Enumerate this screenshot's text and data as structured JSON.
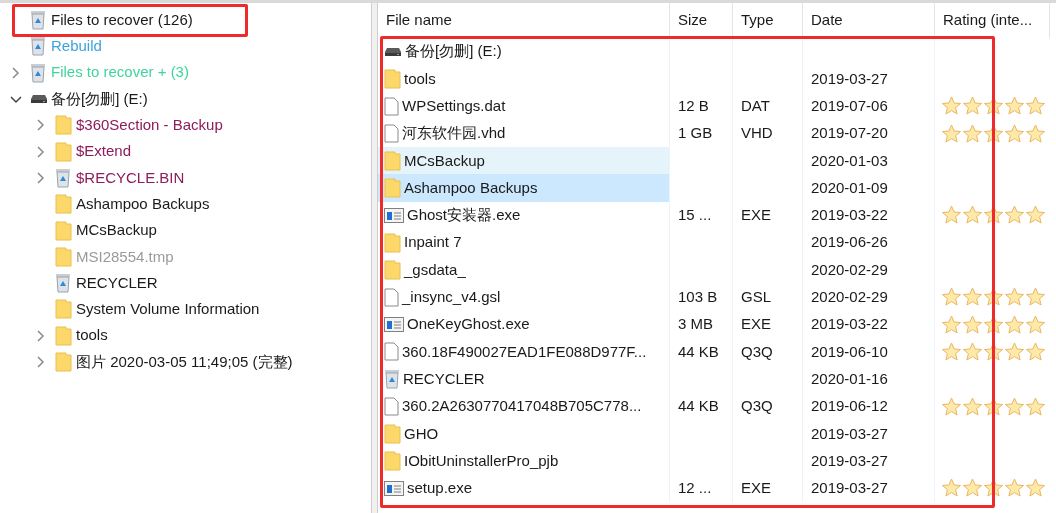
{
  "tree": [
    {
      "label": "Files to recover (126)",
      "kind": "recycle",
      "expandable": false,
      "color": "#1a1a1a",
      "highlighted": true
    },
    {
      "label": "Rebuild",
      "kind": "recycle",
      "expandable": false,
      "color": "#3ba3dc",
      "highlighted": false
    },
    {
      "label": "Files to recover + (3)",
      "kind": "recycle",
      "expandable": true,
      "expanded": false,
      "color": "#3fd49c",
      "highlighted": false
    },
    {
      "label": "备份[勿删] (E:)",
      "kind": "drive",
      "expandable": true,
      "expanded": true,
      "color": "#1a1a1a",
      "highlighted": false,
      "children": [
        {
          "label": "$360Section - Backup",
          "kind": "folder",
          "expandable": true,
          "expanded": false,
          "color": "#8e1b5c",
          "highlighted": false
        },
        {
          "label": "$Extend",
          "kind": "folder",
          "expandable": true,
          "expanded": false,
          "color": "#8e1b5c",
          "highlighted": false
        },
        {
          "label": "$RECYCLE.BIN",
          "kind": "recycle",
          "expandable": true,
          "expanded": false,
          "color": "#8e1b5c",
          "highlighted": false
        },
        {
          "label": "Ashampoo Backups",
          "kind": "folder",
          "expandable": false,
          "color": "#1a1a1a",
          "highlighted": false
        },
        {
          "label": "MCsBackup",
          "kind": "folder",
          "expandable": false,
          "color": "#1a1a1a",
          "highlighted": false
        },
        {
          "label": "MSI28554.tmp",
          "kind": "folder",
          "expandable": false,
          "color": "#9a9a9a",
          "highlighted": false
        },
        {
          "label": "RECYCLER",
          "kind": "recycle",
          "expandable": false,
          "color": "#1a1a1a",
          "highlighted": false
        },
        {
          "label": "System Volume Information",
          "kind": "folder",
          "expandable": false,
          "color": "#1a1a1a",
          "highlighted": false
        },
        {
          "label": "tools",
          "kind": "folder",
          "expandable": true,
          "expanded": false,
          "color": "#1a1a1a",
          "highlighted": false
        },
        {
          "label": "图片 2020-03-05 11;49;05 (完整)",
          "kind": "folder",
          "expandable": true,
          "expanded": false,
          "color": "#1a1a1a",
          "highlighted": false
        }
      ]
    }
  ],
  "table": {
    "highlighted": true,
    "columns": [
      "File name",
      "Size",
      "Type",
      "Date",
      "Rating (inte..."
    ],
    "rows": [
      {
        "kind": "drive",
        "name": "备份[勿删] (E:)",
        "selected": false,
        "hover": false
      },
      {
        "kind": "folder",
        "name": "tools",
        "date": "2019-03-27",
        "selected": false,
        "hover": false
      },
      {
        "kind": "file",
        "name": "WPSettings.dat",
        "size": "12 B",
        "type": "DAT",
        "date": "2019-07-06",
        "stars": 5,
        "selected": false,
        "hover": false
      },
      {
        "kind": "file",
        "name": "河东软件园.vhd",
        "size": "1 GB",
        "type": "VHD",
        "date": "2019-07-20",
        "stars": 5,
        "selected": false,
        "hover": false
      },
      {
        "kind": "folder",
        "name": "MCsBackup",
        "date": "2020-01-03",
        "selected": false,
        "hover": true
      },
      {
        "kind": "folder",
        "name": "Ashampoo Backups",
        "date": "2020-01-09",
        "selected": true,
        "hover": false
      },
      {
        "kind": "exe",
        "name": "Ghost安装器.exe",
        "size": "15 ...",
        "type": "EXE",
        "date": "2019-03-22",
        "stars": 5,
        "selected": false,
        "hover": false
      },
      {
        "kind": "folder",
        "name": "Inpaint 7",
        "date": "2019-06-26",
        "selected": false,
        "hover": false
      },
      {
        "kind": "folder",
        "name": "_gsdata_",
        "date": "2020-02-29",
        "selected": false,
        "hover": false
      },
      {
        "kind": "file",
        "name": "_insync_v4.gsl",
        "size": "103 B",
        "type": "GSL",
        "date": "2020-02-29",
        "stars": 5,
        "selected": false,
        "hover": false
      },
      {
        "kind": "exe",
        "name": "OneKeyGhost.exe",
        "size": "3 MB",
        "type": "EXE",
        "date": "2019-03-22",
        "stars": 5,
        "selected": false,
        "hover": false
      },
      {
        "kind": "file",
        "name": "360.18F490027EAD1FE088D977F...",
        "size": "44 KB",
        "type": "Q3Q",
        "date": "2019-06-10",
        "stars": 5,
        "selected": false,
        "hover": false
      },
      {
        "kind": "recycle",
        "name": "RECYCLER",
        "date": "2020-01-16",
        "selected": false,
        "hover": false
      },
      {
        "kind": "file",
        "name": "360.2A2630770417048B705C778...",
        "size": "44 KB",
        "type": "Q3Q",
        "date": "2019-06-12",
        "stars": 5,
        "selected": false,
        "hover": false
      },
      {
        "kind": "folder",
        "name": "GHO",
        "date": "2019-03-27",
        "selected": false,
        "hover": false
      },
      {
        "kind": "folder",
        "name": "IObitUninstallerPro_pjb",
        "date": "2019-03-27",
        "selected": false,
        "hover": false
      },
      {
        "kind": "exe",
        "name": "setup.exe",
        "size": "12 ...",
        "type": "EXE",
        "date": "2019-03-27",
        "stars": 5,
        "selected": false,
        "hover": false
      }
    ]
  }
}
